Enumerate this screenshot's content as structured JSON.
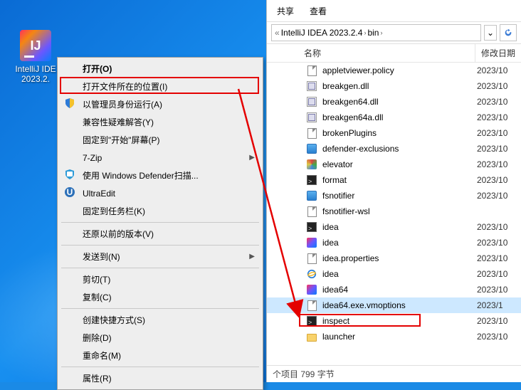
{
  "desktop": {
    "icon_label_line1": "IntelliJ IDE",
    "icon_label_line2": "2023.2.",
    "ij_text": "IJ"
  },
  "context_menu": {
    "open": "打开(O)",
    "open_location": "打开文件所在的位置(I)",
    "run_admin": "以管理员身份运行(A)",
    "troubleshoot": "兼容性疑难解答(Y)",
    "pin_start": "固定到\"开始\"屏幕(P)",
    "seven_zip": "7-Zip",
    "defender": "使用 Windows Defender扫描...",
    "ultraedit": "UltraEdit",
    "pin_taskbar": "固定到任务栏(K)",
    "restore": "还原以前的版本(V)",
    "send_to": "发送到(N)",
    "cut": "剪切(T)",
    "copy": "复制(C)",
    "shortcut": "创建快捷方式(S)",
    "delete": "删除(D)",
    "rename": "重命名(M)",
    "properties": "属性(R)"
  },
  "explorer": {
    "tab_share": "共享",
    "tab_view": "查看",
    "breadcrumb": {
      "item1": "IntelliJ IDEA 2023.2.4",
      "item2": "bin"
    },
    "col_name": "名称",
    "col_date": "修改日期",
    "status": "个项目   799 字节",
    "files": [
      {
        "icon": "page",
        "name": "appletviewer.policy",
        "date": "2023/10"
      },
      {
        "icon": "dll",
        "name": "breakgen.dll",
        "date": "2023/10"
      },
      {
        "icon": "dll",
        "name": "breakgen64.dll",
        "date": "2023/10"
      },
      {
        "icon": "dll",
        "name": "breakgen64a.dll",
        "date": "2023/10"
      },
      {
        "icon": "page",
        "name": "brokenPlugins",
        "date": "2023/10"
      },
      {
        "icon": "app",
        "name": "defender-exclusions",
        "date": "2023/10"
      },
      {
        "icon": "elev",
        "name": "elevator",
        "date": "2023/10"
      },
      {
        "icon": "cmd",
        "name": "format",
        "date": "2023/10"
      },
      {
        "icon": "app",
        "name": "fsnotifier",
        "date": "2023/10"
      },
      {
        "icon": "page",
        "name": "fsnotifier-wsl",
        "date": ""
      },
      {
        "icon": "cmd",
        "name": "idea",
        "date": "2023/10"
      },
      {
        "icon": "ij",
        "name": "idea",
        "date": "2023/10"
      },
      {
        "icon": "page",
        "name": "idea.properties",
        "date": "2023/10"
      },
      {
        "icon": "ie",
        "name": "idea",
        "date": "2023/10"
      },
      {
        "icon": "ij",
        "name": "idea64",
        "date": "2023/10"
      },
      {
        "icon": "page",
        "name": "idea64.exe.vmoptions",
        "date": "2023/1",
        "selected": true
      },
      {
        "icon": "cmd",
        "name": "inspect",
        "date": "2023/10"
      },
      {
        "icon": "fld",
        "name": "launcher",
        "date": "2023/10"
      }
    ]
  }
}
